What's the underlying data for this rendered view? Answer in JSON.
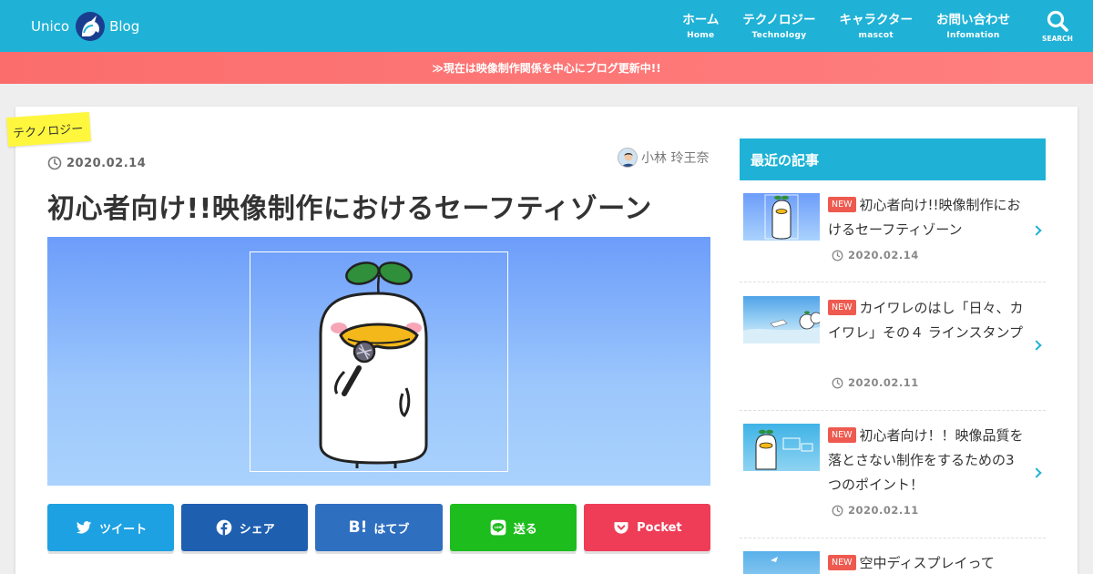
{
  "header": {
    "logo_left": "Unico",
    "logo_right": "Blog",
    "nav": [
      {
        "label": "ホーム",
        "sub": "Home"
      },
      {
        "label": "テクノロジー",
        "sub": "Technology"
      },
      {
        "label": "キャラクター",
        "sub": "mascot"
      },
      {
        "label": "お問い合わせ",
        "sub": "Infomation"
      }
    ],
    "search_label": "SEARCH"
  },
  "notice": {
    "text": "≫現在は映像制作関係を中心にブログ更新中!!"
  },
  "article": {
    "category": "テクノロジー",
    "date": "2020.02.14",
    "author": "小林 玲王奈",
    "title": "初心者向け!!映像制作におけるセーフティゾーン"
  },
  "share": {
    "twitter": "ツイート",
    "facebook": "シェア",
    "hatena_mark": "B!",
    "hatena": "はてブ",
    "line": "送る",
    "pocket": "Pocket"
  },
  "sidebar": {
    "title": "最近の記事",
    "badge": "NEW",
    "items": [
      {
        "title": "初心者向け!!映像制作におけるセーフティゾーン",
        "date": "2020.02.14"
      },
      {
        "title": "カイワレのはし「日々、カイワレ」その４ ラインスタンプ",
        "date": "2020.02.11"
      },
      {
        "title": "初心者向け！！映像品質を落とさない制作をするための3つのポイント！",
        "date": "2020.02.11"
      },
      {
        "title": "空中ディスプレイって",
        "date": ""
      }
    ]
  },
  "colors": {
    "header": "#1fb2d6",
    "notice": "#fb6d6d",
    "category_label": "#fff73d",
    "new_badge": "#ee5a4f",
    "twitter": "#1da1e2",
    "facebook": "#1f5fb0",
    "hatena": "#2f6fc0",
    "line": "#1dbd1d",
    "pocket": "#ef3d57"
  }
}
